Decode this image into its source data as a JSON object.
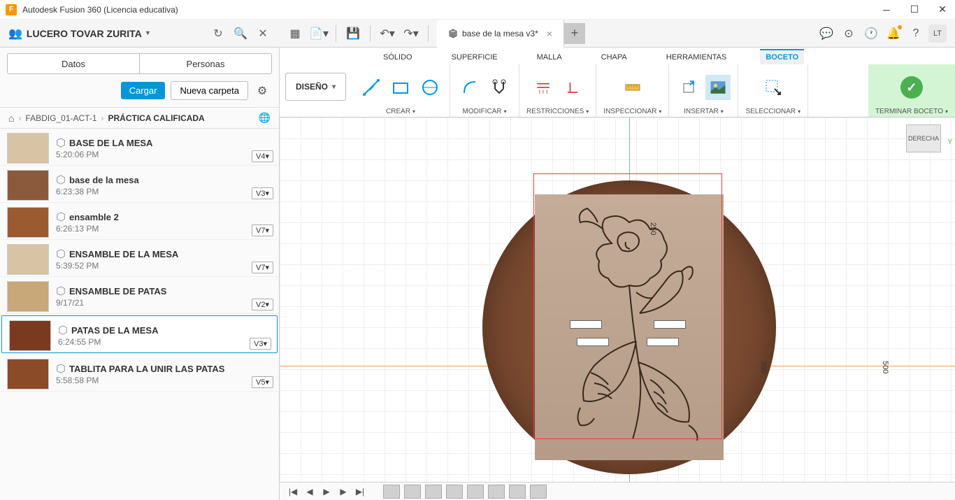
{
  "app": {
    "icon_letter": "F",
    "title": "Autodesk Fusion 360 (Licencia educativa)"
  },
  "user": {
    "name": "LUCERO TOVAR ZURITA",
    "initials": "LT"
  },
  "doc_tab": {
    "name": "base de la mesa v3*"
  },
  "data_panel": {
    "tab_data": "Datos",
    "tab_people": "Personas",
    "btn_load": "Cargar",
    "btn_new_folder": "Nueva carpeta",
    "breadcrumb": {
      "project": "FABDIG_01-ACT-1",
      "folder": "PRÁCTICA CALIFICADA"
    },
    "files": [
      {
        "name": "BASE DE LA MESA",
        "time": "5:20:06 PM",
        "version": "V4",
        "thumb_bg": "#d8c4a4",
        "selected": false
      },
      {
        "name": "base de la mesa",
        "time": "6:23:38 PM",
        "version": "V3",
        "thumb_bg": "#8b5a3c",
        "selected": false
      },
      {
        "name": "ensamble 2",
        "time": "6:26:13 PM",
        "version": "V7",
        "thumb_bg": "#9b5a30",
        "selected": false
      },
      {
        "name": "ENSAMBLE DE LA MESA",
        "time": "5:39:52 PM",
        "version": "V7",
        "thumb_bg": "#d8c4a4",
        "selected": false
      },
      {
        "name": "ENSAMBLE DE PATAS",
        "time": "9/17/21",
        "version": "V2",
        "thumb_bg": "#c8a878",
        "selected": false
      },
      {
        "name": "PATAS DE LA MESA",
        "time": "6:24:55 PM",
        "version": "V3",
        "thumb_bg": "#7a3a20",
        "selected": true
      },
      {
        "name": "TABLITA PARA LA UNIR LAS PATAS",
        "time": "5:58:58 PM",
        "version": "V5",
        "thumb_bg": "#8b4a28",
        "selected": false
      }
    ]
  },
  "ribbon": {
    "design_btn": "DISEÑO",
    "tabs": {
      "solid": "SÓLIDO",
      "surface": "SUPERFICIE",
      "mesh": "MALLA",
      "sheet": "CHAPA",
      "tools": "HERRAMIENTAS",
      "sketch": "BOCETO"
    },
    "groups": {
      "create": "CREAR",
      "modify": "MODIFICAR",
      "constraints": "RESTRICCIONES",
      "inspect": "INSPECCIONAR",
      "insert": "INSERTAR",
      "select": "SELECCIONAR",
      "finish": "TERMINAR BOCETO"
    }
  },
  "canvas": {
    "viewcube_face": "DERECHA",
    "dim_250": "250",
    "dim_350": "350",
    "dim_500": "500"
  }
}
